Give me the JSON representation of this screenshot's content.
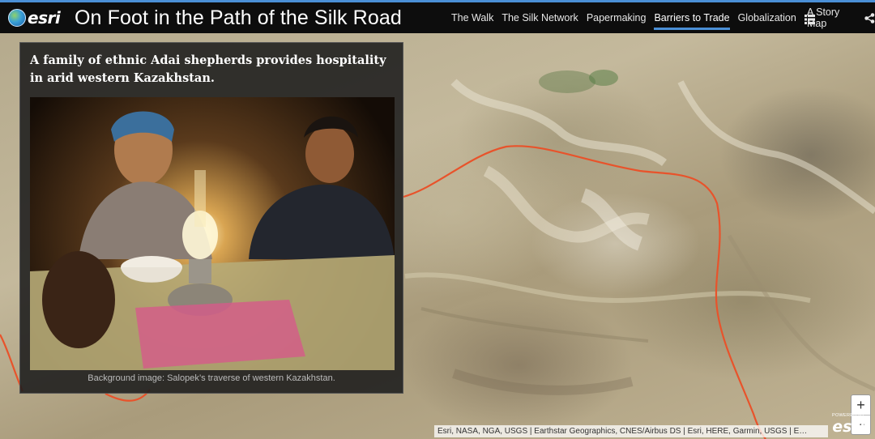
{
  "header": {
    "logo": "esri",
    "title": "On Foot in the Path of the Silk Road",
    "nav": [
      {
        "label": "The Walk"
      },
      {
        "label": "The Silk Network"
      },
      {
        "label": "Papermaking"
      },
      {
        "label": "Barriers to Trade",
        "active": true
      },
      {
        "label": "Globalization"
      }
    ],
    "list_icon": "list-icon",
    "story_link": "A Story Map",
    "share_icon": "share-icon"
  },
  "panel": {
    "title": "A family of ethnic Adai shepherds provides hospitality in arid western Kazakhstan.",
    "caption": "Background image: Salopek’s traverse of western Kazakhstan."
  },
  "map": {
    "zoom_in": "+",
    "zoom_out": "−",
    "attribution": "Esri, NASA, NGA, USGS | Earthstar Geographics, CNES/Airbus DS | Esri, HERE, Garmin, USGS | E…",
    "powered_by": "POWERED BY",
    "powered_logo": "esri",
    "route_color": "#e8532b"
  }
}
